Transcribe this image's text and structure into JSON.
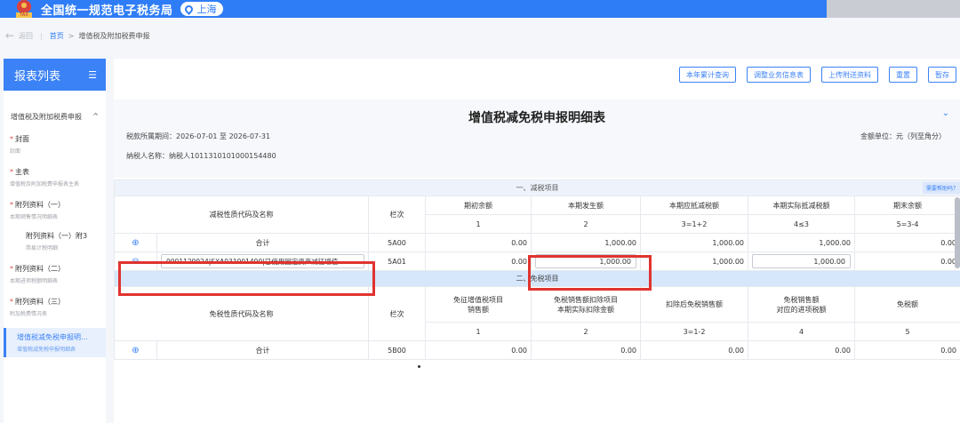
{
  "header": {
    "app_title": "全国统一规范电子税务局",
    "region": "上海",
    "logo_text": "TAX"
  },
  "breadcrumb": {
    "back": "返回",
    "home": "首页",
    "separator": ">",
    "current": "增值税及附加税费申报"
  },
  "sidebar": {
    "title": "报表列表",
    "group": "增值税及附加税费申报",
    "items": [
      {
        "name": "封面",
        "sub": "封面",
        "required": "*"
      },
      {
        "name": "主表",
        "sub": "增值税及附加税费申报表主表",
        "required": "*"
      },
      {
        "name": "附列资料（一）",
        "sub": "本期销售情况明细表",
        "required": "*"
      },
      {
        "name": "附列资料（一）附3",
        "sub": "简易计税明细"
      },
      {
        "name": "附列资料（二）",
        "sub": "本期进项税额明细表",
        "required": "*"
      },
      {
        "name": "附列资料（三）",
        "sub": "附加税费情况表",
        "required": "*"
      },
      {
        "name": "增值税减免税申报明...",
        "sub": "增值税减免税申报明细表"
      }
    ]
  },
  "toolbar": {
    "btn1": "本年累计查询",
    "btn2": "调整业务信息表",
    "btn3": "上传附送资料",
    "btn4": "重置",
    "btn5": "暂存"
  },
  "form": {
    "title": "增值税减免税申报明细表",
    "period": "税款所属期间：2026-07-01 至 2026-07-31",
    "unit": "金额单位：元（列至角分）",
    "taxpayer": "纳税人名称：纳税人1011310101000154480"
  },
  "section1": {
    "title": "一、减税项目",
    "help": "需要帮助吗？",
    "col_name": "减税性质代码及名称",
    "col_line": "栏次",
    "headers": [
      "期初余额",
      "本期发生额",
      "本期应抵减税额",
      "本期实际抵减税额",
      "期末余额"
    ],
    "formulas": [
      "1",
      "2",
      "3=1+2",
      "4≤3",
      "5=3-4"
    ],
    "total": {
      "label": "合计",
      "line": "5A00",
      "values": [
        "0.00",
        "1,000.00",
        "1,000.00",
        "1,000.00",
        "0.00"
      ]
    },
    "row1": {
      "select": "0001129924|SXA031901490|已使用固定资产减征增值...",
      "line": "5A01",
      "values": [
        "0.00",
        "1,000.00",
        "1,000.00",
        "1,000.00",
        "0.00"
      ]
    }
  },
  "section2": {
    "title": "二、免税项目",
    "col_name": "免税性质代码及名称",
    "col_line": "栏次",
    "h1a": "免征增值税项目",
    "h1b": "销售额",
    "h2a": "免税销售额扣除项目",
    "h2b": "本期实际扣除金额",
    "h3": "扣除后免税销售额",
    "h4a": "免税销售额",
    "h4b": "对应的进项税额",
    "h5": "免税额",
    "formulas": [
      "1",
      "2",
      "3=1-2",
      "4",
      "5"
    ],
    "total": {
      "label": "合计",
      "line": "5B00",
      "values": [
        "0.00",
        "0.00",
        "0.00",
        "0.00",
        "0.00"
      ]
    }
  },
  "icons": {
    "expand": "⊕",
    "collapse_row": "⊖",
    "caret": "⌄",
    "menu": "☰",
    "back_arrow": "←"
  },
  "colors": {
    "primary": "#2f7df6",
    "highlight": "#e0332f"
  }
}
